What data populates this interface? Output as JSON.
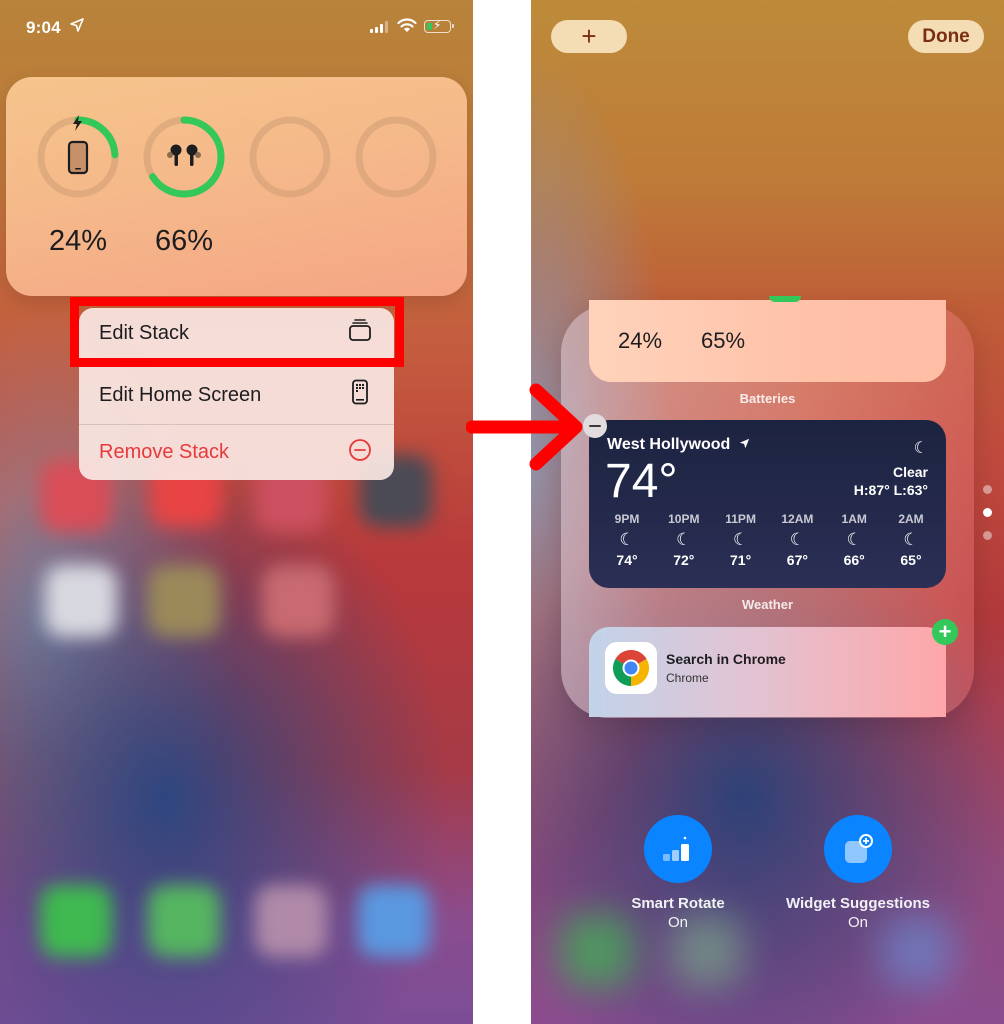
{
  "left_screen": {
    "status_bar": {
      "time": "9:04",
      "location_icon": "location-arrow-icon",
      "signal_icon": "cellular-signal-icon",
      "wifi_icon": "wifi-icon",
      "battery_icon": "battery-charging-icon",
      "battery_fill_fraction": 0.24
    },
    "battery_widget": {
      "devices": [
        {
          "name": "iPhone",
          "icon": "iphone-icon",
          "level_percent": 24,
          "label": "24%",
          "charging": true
        },
        {
          "name": "AirPods",
          "icon": "airpods-icon",
          "level_percent": 66,
          "label": "66%",
          "charging": false
        },
        {
          "name": "empty-slot-3",
          "icon": "",
          "level_percent": 0,
          "label": "",
          "charging": false
        },
        {
          "name": "empty-slot-4",
          "icon": "",
          "level_percent": 0,
          "label": "",
          "charging": false
        }
      ]
    },
    "context_menu": {
      "items": [
        {
          "label": "Edit Stack",
          "icon": "stack-icon",
          "destructive": false,
          "highlighted": true
        },
        {
          "label": "Edit Home Screen",
          "icon": "home-screen-phone-icon",
          "destructive": false,
          "highlighted": false
        },
        {
          "label": "Remove Stack",
          "icon": "minus-circle-icon",
          "destructive": true,
          "highlighted": false
        }
      ]
    }
  },
  "right_screen": {
    "top_bar": {
      "add_label": "+",
      "done_label": "Done"
    },
    "stack": {
      "widgets": [
        {
          "caption": "Batteries",
          "values": [
            "24%",
            "65%"
          ]
        },
        {
          "caption": "Weather",
          "location": "West Hollywood",
          "current_temp": "74°",
          "condition": "Clear",
          "high_low": "H:87° L:63°",
          "hourly": [
            {
              "time": "9PM",
              "icon": "moon-stars-icon",
              "temp": "74°"
            },
            {
              "time": "10PM",
              "icon": "moon-stars-icon",
              "temp": "72°"
            },
            {
              "time": "11PM",
              "icon": "moon-stars-icon",
              "temp": "71°"
            },
            {
              "time": "12AM",
              "icon": "moon-stars-icon",
              "temp": "67°"
            },
            {
              "time": "1AM",
              "icon": "moon-stars-icon",
              "temp": "66°"
            },
            {
              "time": "2AM",
              "icon": "moon-stars-icon",
              "temp": "65°"
            }
          ]
        },
        {
          "title": "Search in Chrome",
          "subtitle": "Chrome",
          "icon": "chrome-icon"
        }
      ],
      "page_count": 3,
      "active_page": 2
    },
    "toggles": [
      {
        "label": "Smart Rotate",
        "state": "On",
        "icon": "smart-rotate-icon"
      },
      {
        "label": "Widget Suggestions",
        "state": "On",
        "icon": "widget-suggestions-icon"
      }
    ]
  },
  "annotation": {
    "highlight_color": "#ff0000",
    "arrow_color": "#ff0000"
  },
  "colors": {
    "ring_green": "#34c759",
    "destructive_red": "#e8393a",
    "toggle_blue": "#0a84ff",
    "done_text": "#7a2e12"
  }
}
